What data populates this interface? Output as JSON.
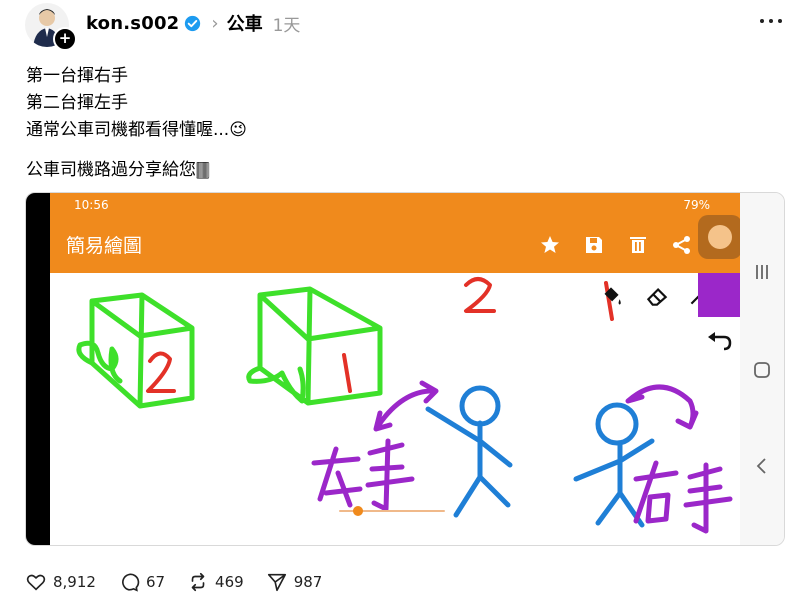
{
  "post": {
    "username": "kon.s002",
    "verified_icon": "verified-badge-icon",
    "topic": "公車",
    "time_ago": "1天",
    "lines": [
      "第一台揮右手",
      "第二台揮左手",
      "通常公車司機都看得懂喔...😉",
      "公車司機路過分享給您🀫"
    ]
  },
  "screenshot": {
    "status_time": "10:56",
    "status_battery": "79%",
    "app_title": "簡易繪圖",
    "accent": "#f08a1c",
    "drawing_labels": [
      "2",
      "1",
      "2",
      "1",
      "左手",
      "右手"
    ]
  },
  "actions": {
    "likes": "8,912",
    "comments": "67",
    "reposts": "469",
    "shares": "987"
  }
}
